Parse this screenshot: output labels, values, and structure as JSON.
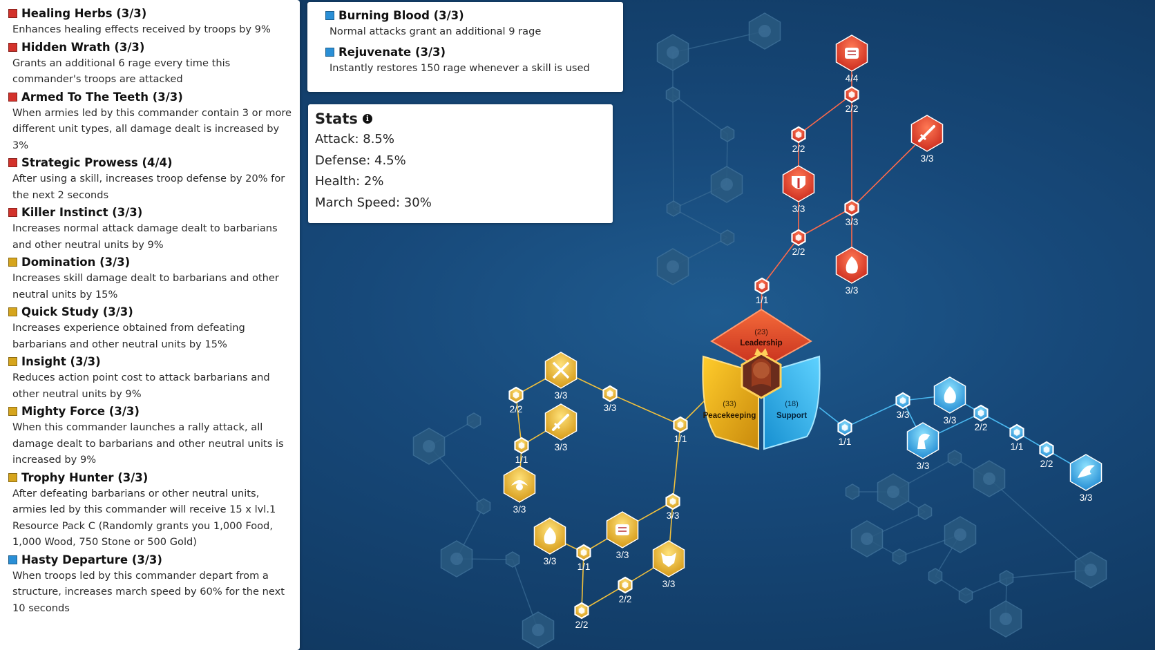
{
  "left_panel": {
    "talents": [
      {
        "name": "Healing Herbs (3/3)",
        "color": "#d3322b",
        "desc": "Enhances healing effects received by troops by 9%"
      },
      {
        "name": "Hidden Wrath (3/3)",
        "color": "#d3322b",
        "desc": "Grants an additional 6 rage every time this commander's troops are attacked"
      },
      {
        "name": "Armed To The Teeth (3/3)",
        "color": "#d3322b",
        "desc": "When armies led by this commander contain 3 or more different unit types, all damage dealt is increased by 3%"
      },
      {
        "name": "Strategic Prowess (4/4)",
        "color": "#d3322b",
        "desc": "After using a skill, increases troop defense by 20% for the next 2 seconds"
      },
      {
        "name": "Killer Instinct (3/3)",
        "color": "#d3322b",
        "desc": "Increases normal attack damage dealt to barbarians and other neutral units by 9%"
      },
      {
        "name": "Domination (3/3)",
        "color": "#d6a51d",
        "desc": "Increases skill damage dealt to barbarians and other neutral units by 15%"
      },
      {
        "name": "Quick Study (3/3)",
        "color": "#d6a51d",
        "desc": "Increases experience obtained from defeating barbarians and other neutral units by 15%"
      },
      {
        "name": "Insight (3/3)",
        "color": "#d6a51d",
        "desc": "Reduces action point cost to attack barbarians and other neutral units by 9%"
      },
      {
        "name": "Mighty Force (3/3)",
        "color": "#d6a51d",
        "desc": "When this commander launches a rally attack, all damage dealt to barbarians and other neutral units is increased by 9%"
      },
      {
        "name": "Trophy Hunter (3/3)",
        "color": "#d6a51d",
        "desc": "After defeating barbarians or other neutral units, armies led by this commander will receive 15 x lvl.1 Resource Pack C (Randomly grants you 1,000 Food, 1,000 Wood, 750 Stone or 500 Gold)"
      },
      {
        "name": "Hasty Departure (3/3)",
        "color": "#2a8fd6",
        "desc": "When troops led by this commander depart from a structure, increases march speed by 60% for the next 10 seconds"
      }
    ]
  },
  "top_panel": {
    "talents": [
      {
        "name": "Burning Blood (3/3)",
        "color": "#2a8fd6",
        "desc": "Normal attacks grant an additional 9 rage"
      },
      {
        "name": "Rejuvenate (3/3)",
        "color": "#2a8fd6",
        "desc": "Instantly restores 150 rage whenever a skill is used"
      }
    ]
  },
  "stats": {
    "title": "Stats",
    "info_icon": "info-icon",
    "rows": [
      "Attack: 8.5%",
      "Defense: 4.5%",
      "Health: 2%",
      "March Speed: 30%"
    ]
  },
  "tree": {
    "colors": {
      "red": "#e8472e",
      "gold": "#f0b820",
      "blue": "#2aa8e8",
      "inactive": "#2a5a80"
    },
    "hub": {
      "leadership": {
        "count": "(23)",
        "label": "Leadership"
      },
      "peacekeeping": {
        "count": "(33)",
        "label": "Peacekeeping"
      },
      "support": {
        "count": "(18)",
        "label": "Support"
      },
      "portrait_icon": "commander-portrait-icon"
    },
    "red_labels": [
      "4/4",
      "2/2",
      "2/2",
      "3/3",
      "3/3",
      "3/3",
      "2/2",
      "3/3",
      "1/1"
    ],
    "gold_labels": [
      "3/3",
      "2/2",
      "3/3",
      "3/3",
      "1/1",
      "1/1",
      "3/3",
      "3/3",
      "3/3",
      "3/3",
      "1/1",
      "3/3",
      "2/2",
      "2/2"
    ],
    "blue_labels": [
      "3/3",
      "3/3",
      "1/1",
      "3/3",
      "2/2",
      "1/1",
      "2/2",
      "3/3"
    ],
    "icons": {
      "red": [
        "scroll-icon",
        "shield-swords-icon",
        "sword-icon",
        "flame-wolf-icon"
      ],
      "gold": [
        "crossed-swords-icon",
        "sword-strike-icon",
        "eagle-icon",
        "flame-icon",
        "scroll-icon",
        "wolf-head-icon"
      ],
      "blue": [
        "flame-icon",
        "horse-icon",
        "wing-icon"
      ],
      "inactive": [
        "crown-icon",
        "swirl-icon",
        "anvil-icon",
        "flag-icon",
        "axe-icon",
        "feather-icon",
        "potion-icon",
        "gear-icon",
        "wave-icon",
        "dragon-icon",
        "bread-icon",
        "fleur-icon"
      ]
    }
  }
}
